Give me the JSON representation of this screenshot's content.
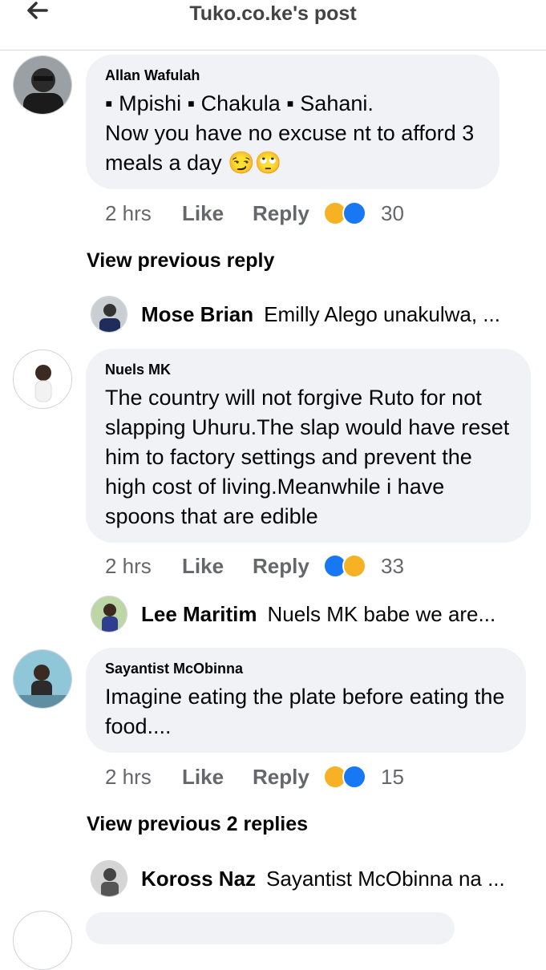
{
  "header": {
    "title": "Tuko.co.ke's post"
  },
  "comments": [
    {
      "author": "Allan Wafulah",
      "lines": [
        "▪ Mpishi  ▪ Chakula  ▪ Sahani.",
        "Now you have no excuse nt to afford 3",
        "meals a day 😏🙄"
      ],
      "time": "2 hrs",
      "like": "Like",
      "reply": "Reply",
      "count": "30",
      "reactions": [
        "haha",
        "like"
      ]
    },
    {
      "author": "Nuels MK",
      "lines": [
        "The country will not forgive Ruto for not",
        "slapping Uhuru.The slap would have reset",
        "him to factory settings and prevent the",
        "high cost of living.Meanwhile i have",
        "spoons that are edible"
      ],
      "time": "2 hrs",
      "like": "Like",
      "reply": "Reply",
      "count": "33",
      "reactions": [
        "like",
        "haha"
      ]
    },
    {
      "author": "Sayantist McObinna",
      "lines": [
        "Imagine eating the plate before eating the",
        "food...."
      ],
      "time": "2 hrs",
      "like": "Like",
      "reply": "Reply",
      "count": "15",
      "reactions": [
        "haha",
        "like"
      ]
    }
  ],
  "view_previous": [
    "View previous reply",
    "View previous 2 replies"
  ],
  "replies": [
    {
      "name": "Mose Brian",
      "snippet": "Emilly Alego unakulwa, ..."
    },
    {
      "name": "Lee Maritim",
      "snippet": "Nuels MK  babe we are..."
    },
    {
      "name": "Koross Naz",
      "snippet": "Sayantist McObinna na ..."
    }
  ],
  "colors": {
    "accent": "#1877f2",
    "haha": "#f7b125",
    "bubble": "#f0f2f5",
    "meta": "#65676b"
  },
  "icons": {
    "back": "back-arrow-icon"
  }
}
